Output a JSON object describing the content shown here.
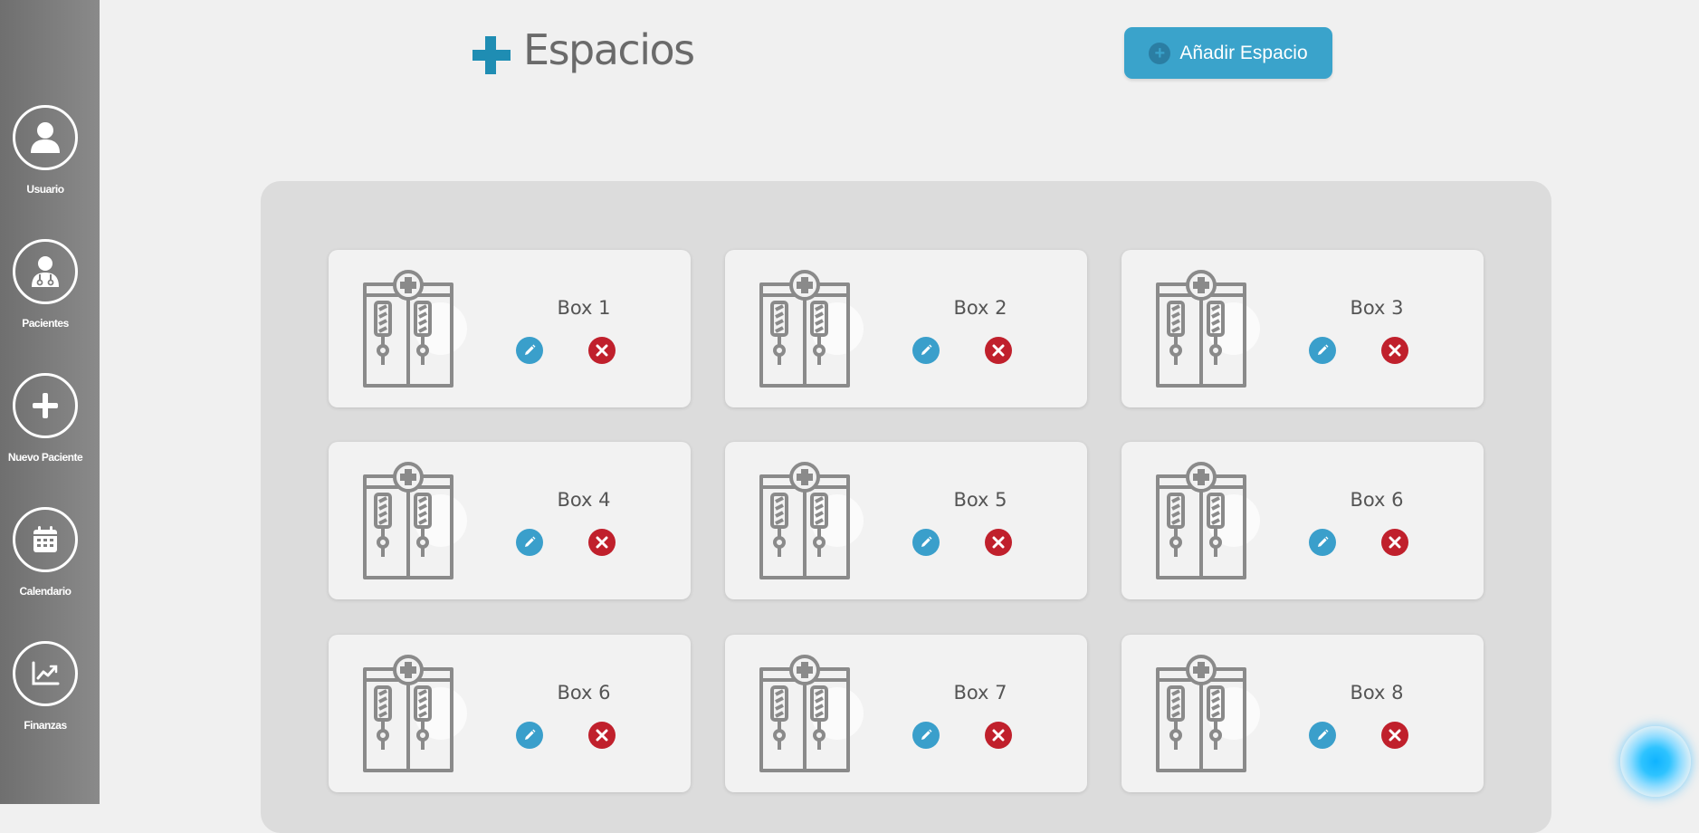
{
  "sidebar": {
    "items": [
      {
        "label": "Usuario",
        "icon": "user-icon"
      },
      {
        "label": "Pacientes",
        "icon": "doctor-icon"
      },
      {
        "label": "Nuevo Paciente",
        "icon": "plus-icon"
      },
      {
        "label": "Calendario",
        "icon": "calendar-icon"
      },
      {
        "label": "Finanzas",
        "icon": "chart-icon"
      }
    ]
  },
  "header": {
    "title": "Espacios",
    "add_button_label": "Añadir Espacio"
  },
  "spaces": [
    {
      "name": "Box 1"
    },
    {
      "name": "Box 2"
    },
    {
      "name": "Box 3"
    },
    {
      "name": "Box 4"
    },
    {
      "name": "Box 5"
    },
    {
      "name": "Box 6"
    },
    {
      "name": "Box 6"
    },
    {
      "name": "Box 7"
    },
    {
      "name": "Box 8"
    }
  ],
  "colors": {
    "accent": "#3aa3cb",
    "title_plus": "#1f8db3",
    "delete": "#c0202c"
  }
}
